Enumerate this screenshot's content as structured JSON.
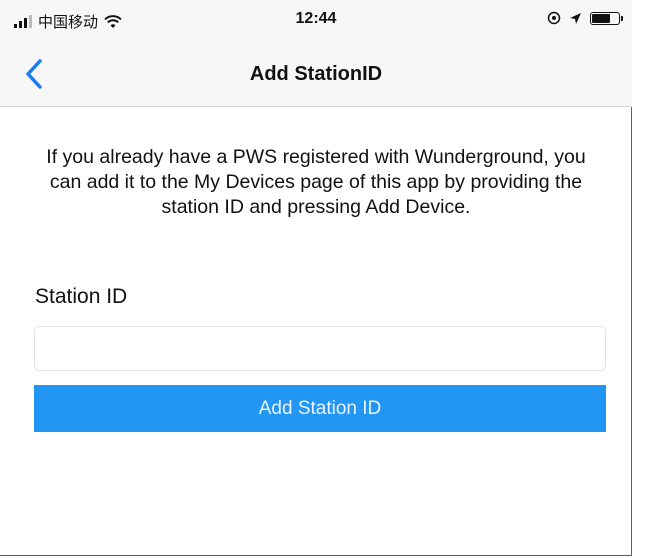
{
  "status_bar": {
    "carrier": "中国移动",
    "time": "12:44"
  },
  "navbar": {
    "title": "Add StationID"
  },
  "content": {
    "description": "If you already have a PWS registered with Wunderground, you can add it to the My Devices page of this app by providing the station ID and pressing Add Device.",
    "station_label": "Station ID",
    "station_value": "",
    "add_button_label": "Add Station ID"
  },
  "colors": {
    "accent": "#2196f3",
    "back_chevron": "#1a7cf5",
    "border": "#2f63d1"
  },
  "icons": [
    "signal-icon",
    "wifi-icon",
    "location-lock-icon",
    "location-arrow-icon",
    "battery-icon",
    "chevron-left-icon"
  ]
}
